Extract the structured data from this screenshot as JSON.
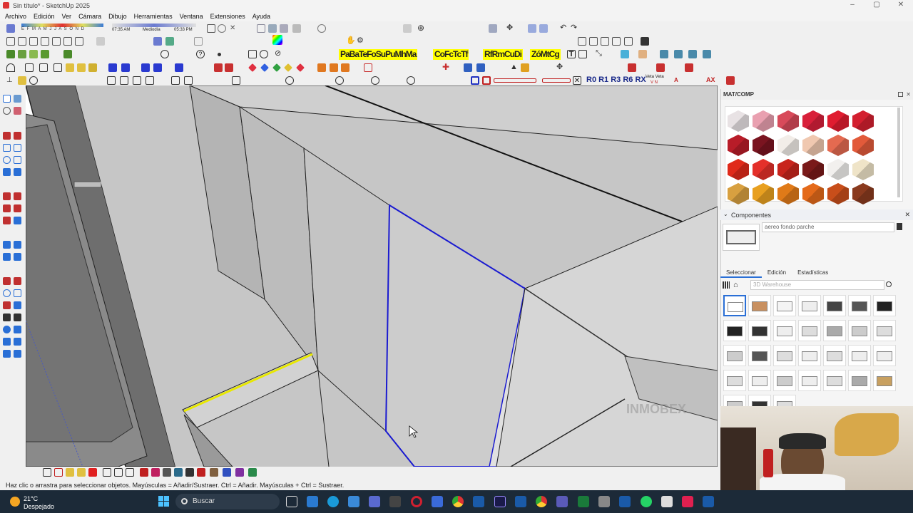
{
  "window": {
    "title": "Sin título* - SketchUp 2025",
    "minimize": "–",
    "maximize": "▢",
    "close": "✕"
  },
  "menu": [
    "Archivo",
    "Edición",
    "Ver",
    "Cámara",
    "Dibujo",
    "Herramientas",
    "Ventana",
    "Extensiones",
    "Ayuda"
  ],
  "shadow_bar": {
    "months": "E F M A M J J A S O N D",
    "time_start": "07:35 AM",
    "time_mid": "Mediodía",
    "time_end": "05:33 PM"
  },
  "yellow_toolbar_1": "PaBaTeFoSuPuMhMa",
  "yellow_toolbar_2": "CoFcTcTf",
  "yellow_toolbar_3": "RfRmCuDi",
  "yellow_toolbar_4": "ZóMtCg",
  "rotation_toolbar": "R0 R1 R3 R6 RX",
  "veta_labels": {
    "top": "Veta Veta",
    "bottom": "V N"
  },
  "statusbar": "Haz clic o arrastra para seleccionar objetos. Mayúsculas = Añadir/Sustraer. Ctrl = Añadir. Mayúsculas + Ctrl = Sustraer.",
  "materials_panel": {
    "title": "MAT/COMP"
  },
  "materials_swatches": [
    "#e8e2e4",
    "#e9a0b0",
    "#d84a5a",
    "#d8203a",
    "#e01c30",
    "#d31f2f",
    "#b81c28",
    "#7a1420",
    "#f2ede8",
    "#f0c8b0",
    "#e46a50",
    "#e25a3a",
    "#e02a1a",
    "#e4302a",
    "#c8241c",
    "#7a1a1a",
    "#f2f0ee",
    "#efe4c8",
    "#d8a040",
    "#e8a020",
    "#e07a18",
    "#e46a1a",
    "#c84e1a",
    "#8a3a1e"
  ],
  "components": {
    "header": "Componentes",
    "search_value": "aereo fondo parche"
  },
  "tabs": [
    "Seleccionar",
    "Edición",
    "Estadísticas"
  ],
  "warehouse_placeholder": "3D Warehouse",
  "watermark": "INMOBEX",
  "taskbar": {
    "temperature": "21°C",
    "weather": "Despejado",
    "search": "Buscar"
  }
}
